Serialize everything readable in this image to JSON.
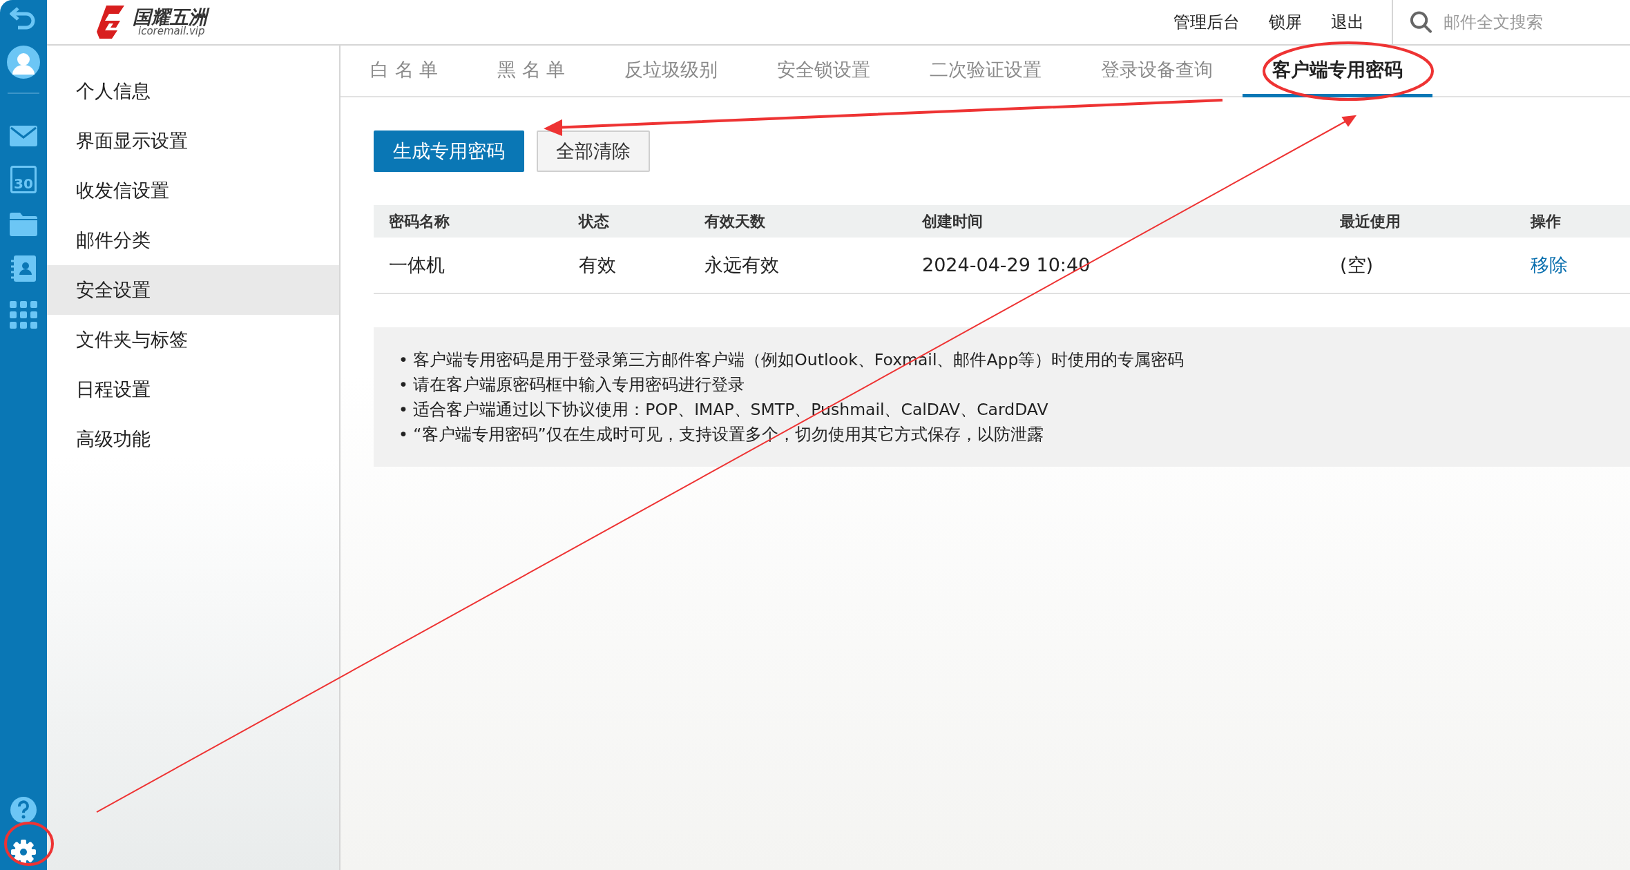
{
  "logo": {
    "name": "国耀五洲",
    "domain": "icoremail.vip"
  },
  "header_links": [
    "管理后台",
    "锁屏",
    "退出"
  ],
  "search": {
    "placeholder": "邮件全文搜索"
  },
  "rail_icons": [
    {
      "kind": "back"
    },
    {
      "kind": "avatar"
    },
    {
      "kind": "mail"
    },
    {
      "kind": "calendar",
      "label": "30"
    },
    {
      "kind": "folder"
    },
    {
      "kind": "contacts"
    },
    {
      "kind": "apps"
    }
  ],
  "rail_bottom": [
    {
      "kind": "help"
    },
    {
      "kind": "settings"
    }
  ],
  "sidebar": {
    "items": [
      {
        "label": "个人信息",
        "selected": false
      },
      {
        "label": "界面显示设置",
        "selected": false
      },
      {
        "label": "收发信设置",
        "selected": false
      },
      {
        "label": "邮件分类",
        "selected": false
      },
      {
        "label": "安全设置",
        "selected": true
      },
      {
        "label": "文件夹与标签",
        "selected": false
      },
      {
        "label": "日程设置",
        "selected": false
      },
      {
        "label": "高级功能",
        "selected": false
      }
    ]
  },
  "tabs": [
    {
      "label": "白 名 单",
      "selected": false
    },
    {
      "label": "黑 名 单",
      "selected": false
    },
    {
      "label": "反垃圾级别",
      "selected": false
    },
    {
      "label": "安全锁设置",
      "selected": false
    },
    {
      "label": "二次验证设置",
      "selected": false
    },
    {
      "label": "登录设备查询",
      "selected": false
    },
    {
      "label": "客户端专用密码",
      "selected": true
    }
  ],
  "buttons": [
    {
      "label": "生成专用密码",
      "kind": "primary"
    },
    {
      "label": "全部清除",
      "kind": "secondary"
    }
  ],
  "table": {
    "columns": [
      "密码名称",
      "状态",
      "有效天数",
      "创建时间",
      "最近使用",
      "操作"
    ],
    "rows": [
      [
        "一体机",
        "有效",
        "永远有效",
        "2024-04-29 10:40",
        "(空)",
        "移除"
      ]
    ]
  },
  "notes": [
    "• 客户端专用密码是用于登录第三方邮件客户端（例如Outlook、Foxmail、邮件App等）时使用的专属密码",
    "• 请在客户端原密码框中输入专用密码进行登录",
    "• 适合客户端通过以下协议使用：POP、IMAP、SMTP、Pushmail、CalDAV、CardDAV",
    "•  “客户端专用密码”仅在生成时可见，支持设置多个，切勿使用其它方式保存，以防泄露"
  ]
}
